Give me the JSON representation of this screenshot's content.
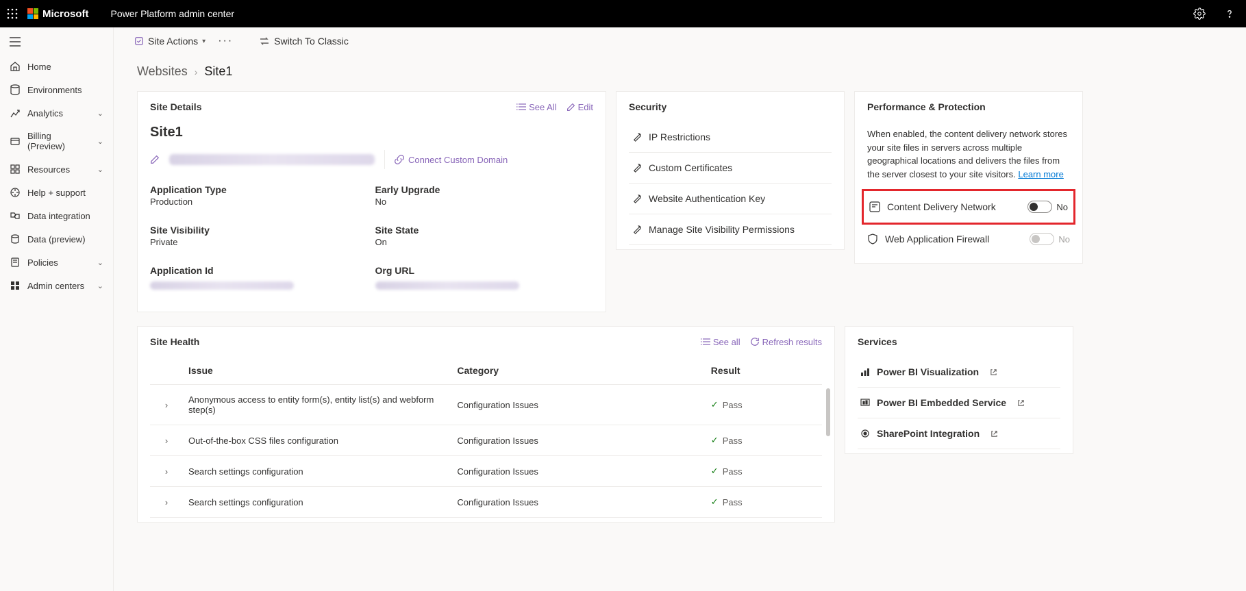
{
  "top": {
    "brand": "Microsoft",
    "product": "Power Platform admin center"
  },
  "leftnav": {
    "items": [
      {
        "icon": "home",
        "label": "Home",
        "chev": false
      },
      {
        "icon": "env",
        "label": "Environments",
        "chev": false
      },
      {
        "icon": "analytics",
        "label": "Analytics",
        "chev": true
      },
      {
        "icon": "billing",
        "label": "Billing (Preview)",
        "chev": true
      },
      {
        "icon": "resources",
        "label": "Resources",
        "chev": true
      },
      {
        "icon": "support",
        "label": "Help + support",
        "chev": false
      },
      {
        "icon": "dataint",
        "label": "Data integration",
        "chev": false
      },
      {
        "icon": "datapre",
        "label": "Data (preview)",
        "chev": false
      },
      {
        "icon": "policies",
        "label": "Policies",
        "chev": true
      },
      {
        "icon": "admin",
        "label": "Admin centers",
        "chev": true
      }
    ]
  },
  "commandbar": {
    "site_actions": "Site Actions",
    "switch": "Switch To Classic"
  },
  "breadcrumb": {
    "parent": "Websites",
    "current": "Site1"
  },
  "site_details": {
    "title": "Site Details",
    "see_all": "See All",
    "edit": "Edit",
    "name": "Site1",
    "connect_domain": "Connect Custom Domain",
    "fields_left": [
      {
        "k": "Application Type",
        "v": "Production"
      },
      {
        "k": "Site Visibility",
        "v": "Private"
      },
      {
        "k": "Application Id",
        "v": ""
      }
    ],
    "fields_right": [
      {
        "k": "Early Upgrade",
        "v": "No"
      },
      {
        "k": "Site State",
        "v": "On"
      },
      {
        "k": "Org URL",
        "v": ""
      }
    ]
  },
  "security": {
    "title": "Security",
    "rows": [
      "IP Restrictions",
      "Custom Certificates",
      "Website Authentication Key",
      "Manage Site Visibility Permissions"
    ]
  },
  "perf": {
    "title": "Performance & Protection",
    "desc": "When enabled, the content delivery network stores your site files in servers across multiple geographical locations and delivers the files from the server closest to your site visitors. ",
    "learn_more": "Learn more",
    "cdn_label": "Content Delivery Network",
    "cdn_state": "No",
    "waf_label": "Web Application Firewall",
    "waf_state": "No"
  },
  "site_health": {
    "title": "Site Health",
    "see_all": "See all",
    "refresh": "Refresh results",
    "cols": {
      "issue": "Issue",
      "cat": "Category",
      "res": "Result"
    },
    "rows": [
      {
        "issue": "Anonymous access to entity form(s), entity list(s) and webform step(s)",
        "cat": "Configuration Issues",
        "res": "Pass"
      },
      {
        "issue": "Out-of-the-box CSS files configuration",
        "cat": "Configuration Issues",
        "res": "Pass"
      },
      {
        "issue": "Search settings configuration",
        "cat": "Configuration Issues",
        "res": "Pass"
      },
      {
        "issue": "Search settings configuration",
        "cat": "Configuration Issues",
        "res": "Pass"
      }
    ]
  },
  "services": {
    "title": "Services",
    "rows": [
      "Power BI Visualization",
      "Power BI Embedded Service",
      "SharePoint Integration"
    ]
  }
}
